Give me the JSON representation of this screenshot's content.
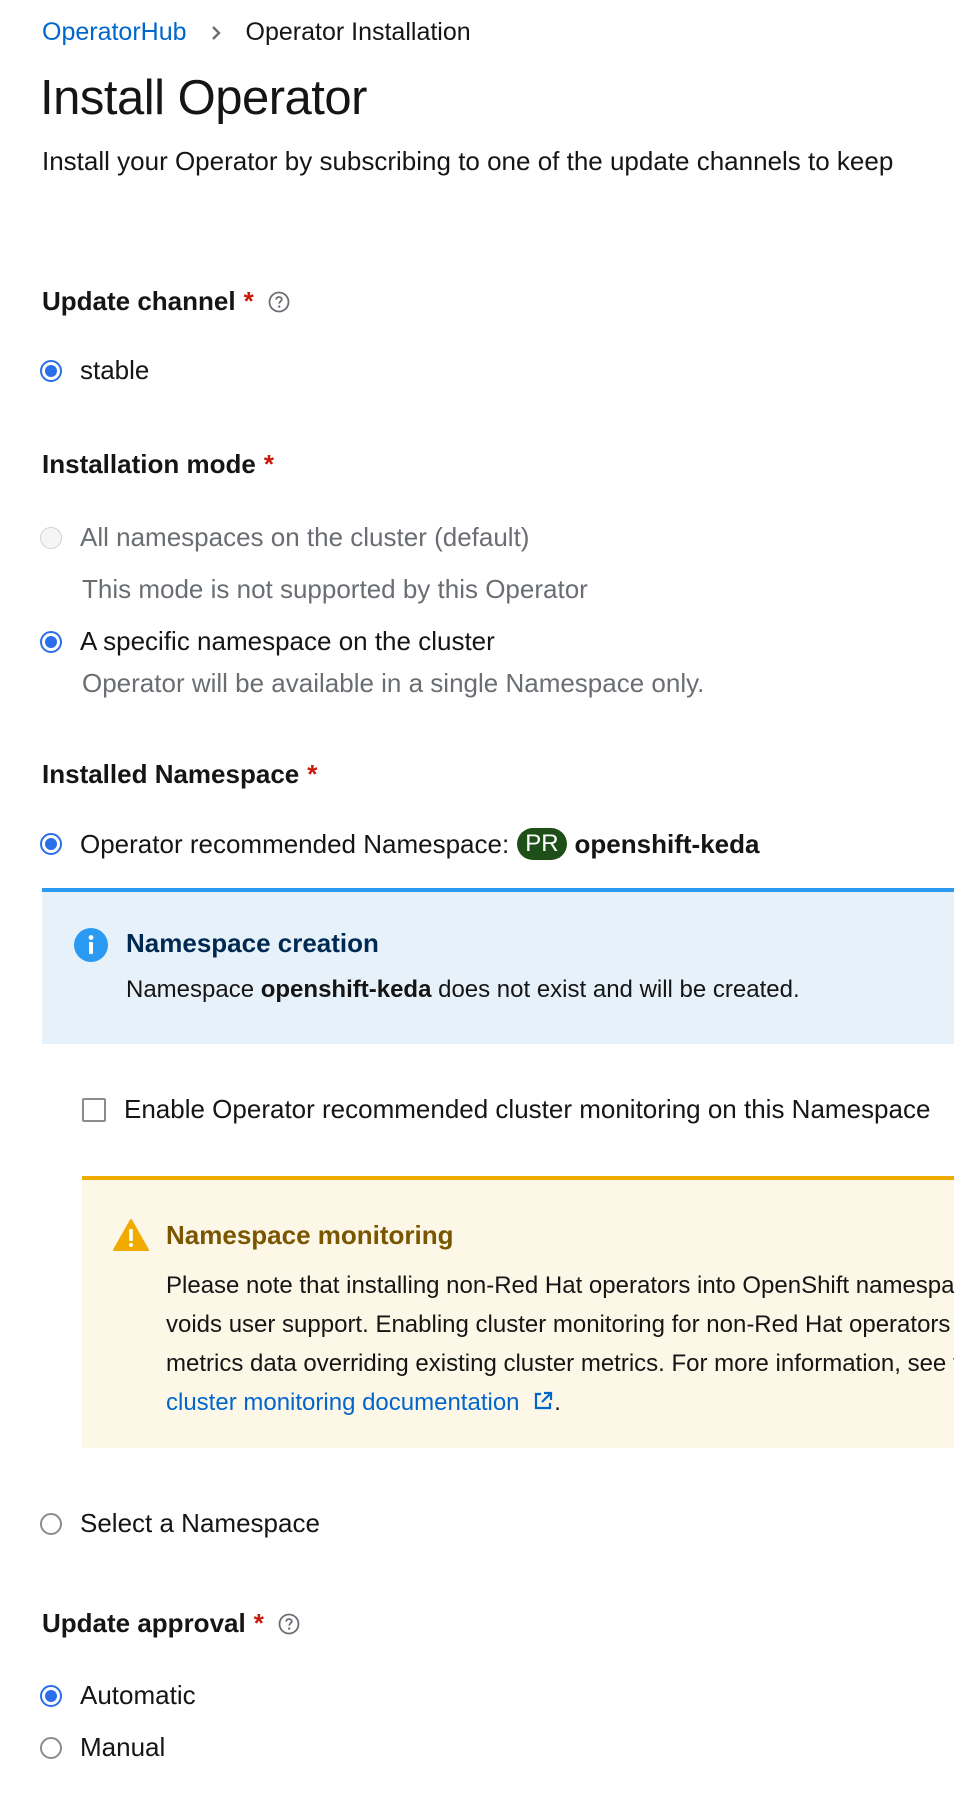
{
  "breadcrumb": {
    "parent": "OperatorHub",
    "current": "Operator Installation"
  },
  "page": {
    "title": "Install Operator",
    "description": "Install your Operator by subscribing to one of the update channels to keep"
  },
  "update_channel": {
    "label": "Update channel",
    "required_mark": "*",
    "options": [
      {
        "label": "stable",
        "selected": true
      }
    ]
  },
  "installation_mode": {
    "label": "Installation mode",
    "required_mark": "*",
    "options": [
      {
        "label": "All namespaces on the cluster (default)",
        "description": "This mode is not supported by this Operator",
        "selected": false,
        "disabled": true
      },
      {
        "label": "A specific namespace on the cluster",
        "description": "Operator will be available in a single Namespace only.",
        "selected": true,
        "disabled": false
      }
    ]
  },
  "installed_namespace": {
    "label": "Installed Namespace",
    "required_mark": "*",
    "recommended_option": {
      "label": "Operator recommended Namespace:",
      "badge": "PR",
      "namespace": "openshift-keda",
      "selected": true
    },
    "info_alert": {
      "title": "Namespace creation",
      "body_prefix": "Namespace",
      "body_namespace": "openshift-keda",
      "body_suffix": "does not exist and will be created."
    },
    "monitoring_checkbox": {
      "label": "Enable Operator recommended cluster monitoring on this Namespace",
      "checked": false
    },
    "warning_alert": {
      "title": "Namespace monitoring",
      "lines": [
        "Please note that installing non-Red Hat operators into OpenShift namespaces and enabling monitoring",
        "voids user support. Enabling cluster monitoring for non-Red Hat operators can lead to malicious",
        "metrics data overriding existing cluster metrics. For more information, see the"
      ],
      "link_text": "cluster monitoring documentation",
      "link_suffix": "."
    },
    "select_option": {
      "label": "Select a Namespace",
      "selected": false
    }
  },
  "update_approval": {
    "label": "Update approval",
    "required_mark": "*",
    "options": [
      {
        "label": "Automatic",
        "selected": true
      },
      {
        "label": "Manual",
        "selected": false
      }
    ]
  },
  "icons": {
    "breadcrumb_separator": "chevron-right-icon",
    "help": "question-circle-icon",
    "info": "info-circle-icon",
    "warning": "warning-triangle-icon",
    "external_link": "external-link-icon"
  },
  "colors": {
    "link": "#0066cc",
    "radio_selected": "#2b6ee9",
    "required": "#c9190b",
    "info_border": "#2b9af3",
    "info_bg": "#e7f1fa",
    "warning_border": "#f0ab00",
    "warning_bg": "#fdf7e7",
    "warning_title": "#795600",
    "badge_bg": "#1e4f18"
  }
}
